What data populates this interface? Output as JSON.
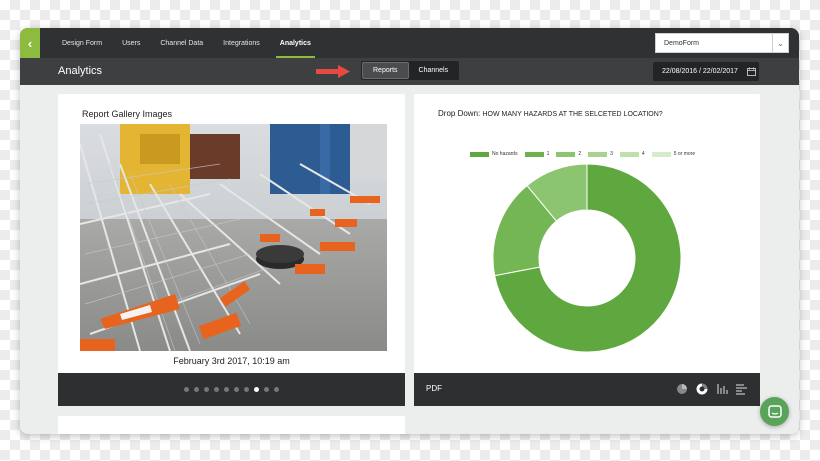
{
  "topnav": {
    "items": [
      {
        "label": "Design Form"
      },
      {
        "label": "Users"
      },
      {
        "label": "Channel Data"
      },
      {
        "label": "Integrations"
      },
      {
        "label": "Analytics",
        "active": true
      }
    ],
    "form_select": {
      "value": "DemoForm"
    }
  },
  "subheader": {
    "title": "Analytics",
    "toggle": [
      {
        "label": "Reports",
        "active": true
      },
      {
        "label": "Channels"
      }
    ],
    "date_range": "22/08/2016 / 22/02/2017"
  },
  "gallery": {
    "title": "Report Gallery Images",
    "caption": "February 3rd 2017, 10:19 am",
    "dots_total": 10,
    "dots_active_index": 7
  },
  "dropdown_card": {
    "prefix": "Drop Down:",
    "question": "HOW MANY HAZARDS AT THE SELCETED LOCATION?",
    "legend": [
      {
        "label": "No hazards",
        "color": "#5ea83f"
      },
      {
        "label": "1",
        "color": "#6db24e"
      },
      {
        "label": "2",
        "color": "#8cc56f"
      },
      {
        "label": "3",
        "color": "#a7d38f"
      },
      {
        "label": "4",
        "color": "#bfe0ad"
      },
      {
        "label": "5 or more",
        "color": "#d5ecc8"
      }
    ],
    "footer_label": "PDF",
    "chart_icons": [
      "pie-chart-icon",
      "donut-chart-icon",
      "bar-chart-icon",
      "horizontal-bar-chart-icon"
    ]
  },
  "chart_data": {
    "type": "pie",
    "labels": [
      "No hazards",
      "1",
      "2",
      "3",
      "4",
      "5 or more"
    ],
    "values": [
      72,
      17,
      11,
      0,
      0,
      0
    ],
    "colors": [
      "#5ea83f",
      "#73b653",
      "#8cc56f",
      "#a7d38f",
      "#bfe0ad",
      "#d5ecc8"
    ],
    "donut": true
  },
  "colors": {
    "accent": "#8cbb3f",
    "nav_bg": "#2f3132",
    "arrow": "#e84a43"
  },
  "chat_button": {
    "icon": "chat-icon"
  }
}
